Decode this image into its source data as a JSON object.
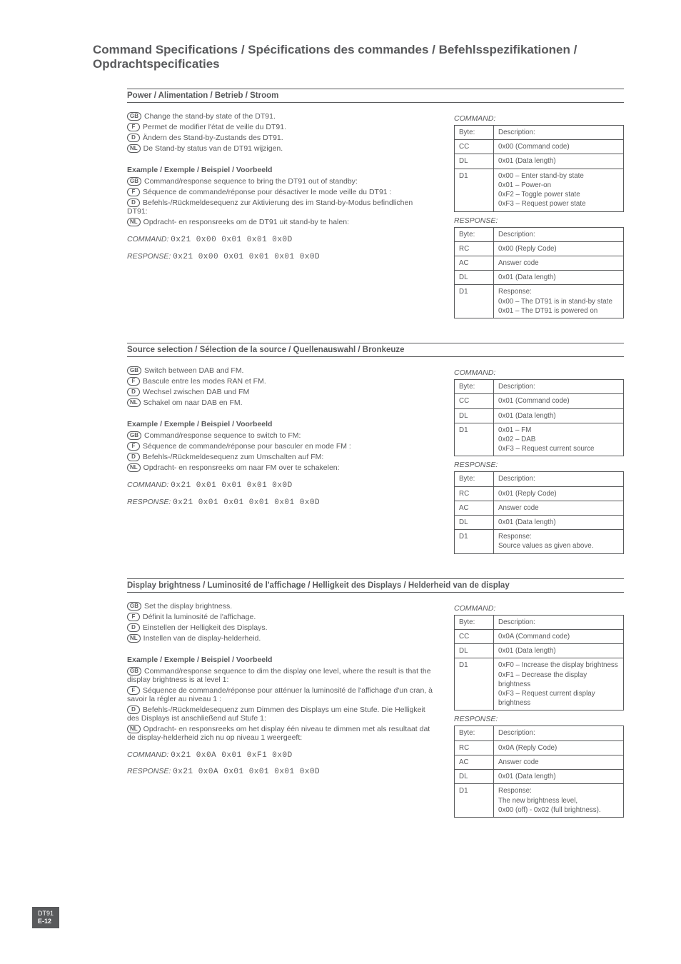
{
  "page_title": "Command Specifications / Spécifications des commandes / Befehlsspezifikationen / Opdrachtspecificaties",
  "badges": {
    "gb": "GB",
    "f": "F",
    "d": "D",
    "nl": "NL"
  },
  "labels": {
    "command": "COMMAND:",
    "response": "RESPONSE:",
    "byte": "Byte:",
    "description": "Description:"
  },
  "section1": {
    "heading": "Power / Alimentation / Betrieb / Stroom",
    "lines": {
      "gb": "Change the stand-by state of the DT91.",
      "f": "Permet de modifier l'état de veille du DT91.",
      "d": "Ändern des Stand-by-Zustands des DT91.",
      "nl": "De Stand-by status van de DT91 wijzigen."
    },
    "example_heading": "Example / Exemple / Beispiel / Voorbeeld",
    "example": {
      "gb": "Command/response sequence to bring the DT91 out of standby:",
      "f": "Séquence de commande/réponse pour désactiver le mode veille du DT91 :",
      "d": "Befehls-/Rückmeldesequenz zur Aktivierung des im Stand-by-Modus befindlichen DT91:",
      "nl": "Opdracht- en responsreeks om de DT91 uit stand-by te halen:"
    },
    "cmd_hex": "0x21 0x00 0x01 0x01 0x0D",
    "resp_hex": "0x21 0x00 0x01 0x01 0x01 0x0D",
    "command_table": [
      [
        "CC",
        "0x00 (Command code)"
      ],
      [
        "DL",
        "0x01 (Data length)"
      ],
      [
        "D1",
        "0x00 – Enter stand-by state\n0x01 – Power-on\n0xF2 – Toggle power state\n0xF3 – Request power state"
      ]
    ],
    "response_table": [
      [
        "RC",
        "0x00 (Reply Code)"
      ],
      [
        "AC",
        "Answer code"
      ],
      [
        "DL",
        "0x01 (Data length)"
      ],
      [
        "D1",
        "Response:\n0x00 – The DT91 is in stand-by state\n0x01 – The DT91 is powered on"
      ]
    ]
  },
  "section2": {
    "heading": "Source selection / Sélection de la source / Quellenauswahl / Bronkeuze",
    "lines": {
      "gb": "Switch between DAB and FM.",
      "f": "Bascule entre les modes RAN et FM.",
      "d": "Wechsel zwischen DAB und FM",
      "nl": "Schakel om naar DAB en FM."
    },
    "example_heading": "Example / Exemple / Beispiel / Voorbeeld",
    "example": {
      "gb": "Command/response sequence to switch to FM:",
      "f": "Séquence de commande/réponse pour basculer en mode FM :",
      "d": "Befehls-/Rückmeldesequenz zum Umschalten auf FM:",
      "nl": "Opdracht- en responsreeks om naar FM over te schakelen:"
    },
    "cmd_hex": "0x21 0x01 0x01 0x01 0x0D",
    "resp_hex": "0x21 0x01 0x01 0x01 0x01 0x0D",
    "command_table": [
      [
        "CC",
        "0x01 (Command code)"
      ],
      [
        "DL",
        "0x01 (Data length)"
      ],
      [
        "D1",
        "0x01 – FM\n0x02 – DAB\n0xF3 – Request current source"
      ]
    ],
    "response_table": [
      [
        "RC",
        "0x01 (Reply Code)"
      ],
      [
        "AC",
        "Answer code"
      ],
      [
        "DL",
        "0x01 (Data length)"
      ],
      [
        "D1",
        "Response:\nSource values as given above."
      ]
    ]
  },
  "section3": {
    "heading": "Display brightness / Luminosité de l'affichage / Helligkeit des Displays / Helderheid van de display",
    "lines": {
      "gb": "Set the display brightness.",
      "f": "Définit la luminosité de l'affichage.",
      "d": "Einstellen der Helligkeit des Displays.",
      "nl": "Instellen van de display-helderheid."
    },
    "example_heading": "Example / Exemple / Beispiel / Voorbeeld",
    "example": {
      "gb": "Command/response sequence to dim the display one level, where the result is that the display brightness is at level 1:",
      "f": "Séquence de commande/réponse pour atténuer la luminosité de l'affichage d'un cran, à savoir la régler au niveau 1 :",
      "d": "Befehls-/Rückmeldesequenz zum Dimmen des Displays um eine Stufe. Die Helligkeit des Displays ist anschließend auf Stufe 1:",
      "nl": "Opdracht- en responsreeks om het display één niveau te dimmen met als resultaat dat de display-helderheid zich nu op niveau 1 weergeeft:"
    },
    "cmd_hex": "0x21 0x0A 0x01 0xF1 0x0D",
    "resp_hex": "0x21 0x0A 0x01 0x01 0x01 0x0D",
    "command_table": [
      [
        "CC",
        "0x0A (Command code)"
      ],
      [
        "DL",
        "0x01 (Data length)"
      ],
      [
        "D1",
        "0xF0 – Increase the display brightness\n0xF1 – Decrease the display brightness\n0xF3 – Request current display brightness"
      ]
    ],
    "response_table": [
      [
        "RC",
        "0x0A (Reply Code)"
      ],
      [
        "AC",
        "Answer code"
      ],
      [
        "DL",
        "0x01 (Data length)"
      ],
      [
        "D1",
        "Response:\nThe new brightness level,\n0x00 (off) - 0x02 (full brightness)."
      ]
    ]
  },
  "footer": {
    "model": "DT91",
    "page": "E-12"
  }
}
